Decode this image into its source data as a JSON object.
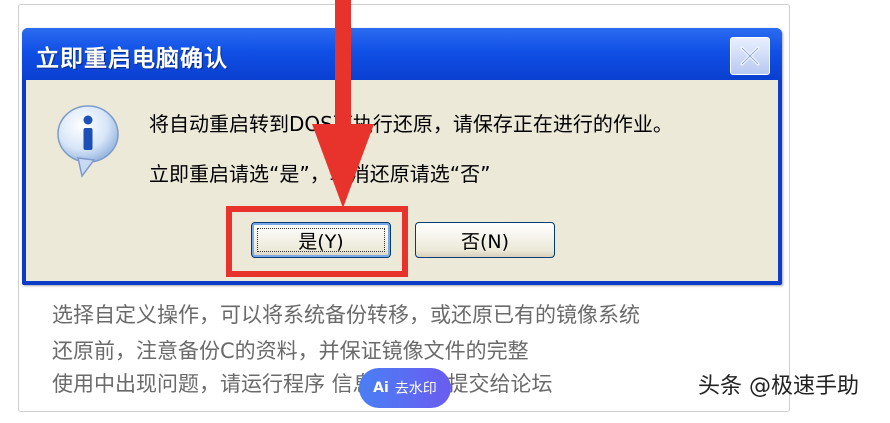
{
  "background_window": {
    "lines": [
      "选择自定义操作，可以将系统备份转移，或还原已有的镜像系统",
      "还原前，注意备份C的资料，并保证镜像文件的完整",
      "使用中出现问题，请运行程序      信息反馈”，提交给论坛"
    ]
  },
  "dialog": {
    "title": "立即重启电脑确认",
    "icon": "info-icon",
    "message_line_1": "将自动重启转到DOS下执行还原，请保存正在进行的作业。",
    "message_line_2": "立即重启请选“是”，取消还原请选“否”",
    "buttons": {
      "yes": "是(Y)",
      "no": "否(N)"
    }
  },
  "watermark": {
    "badge": "Ai",
    "label": "去水印"
  },
  "signature": "头条 @极速手助",
  "colors": {
    "titlebar": "#1150e6",
    "client": "#ece9d8",
    "annotation_red": "#e8332d"
  }
}
